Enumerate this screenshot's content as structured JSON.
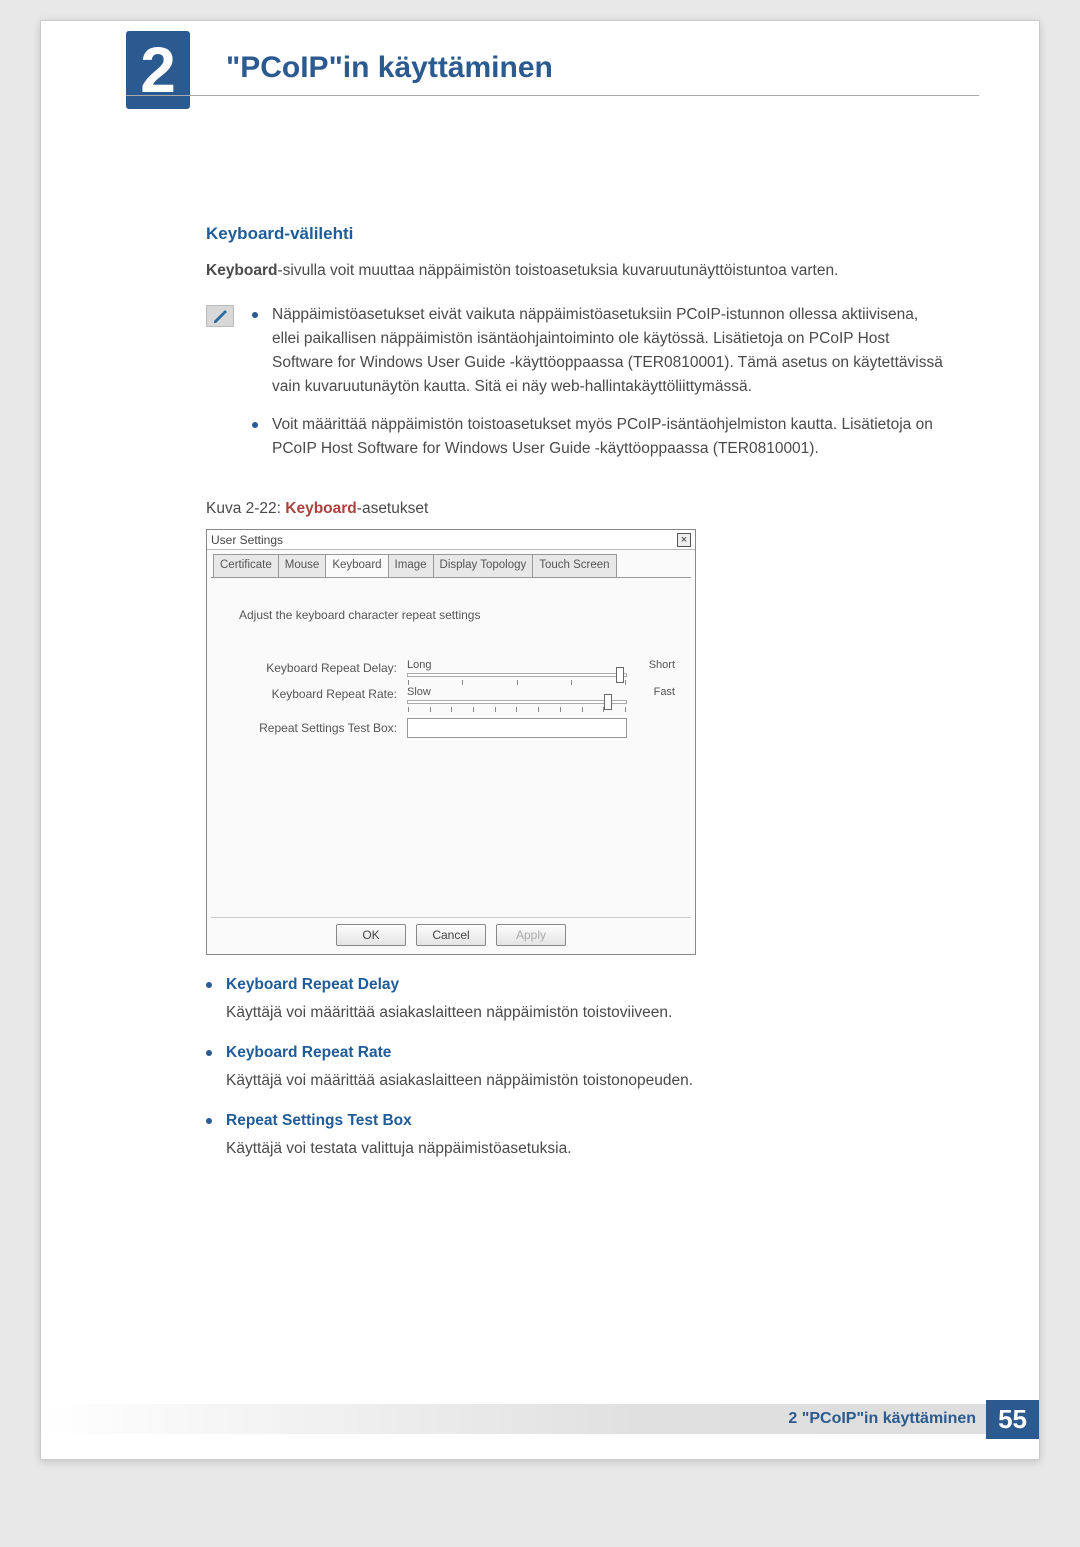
{
  "chapter": {
    "number": "2",
    "title": "\"PCoIP\"in käyttäminen"
  },
  "section": {
    "title": "Keyboard-välilehti",
    "intro_bold": "Keyboard",
    "intro_rest": "-sivulla voit muuttaa näppäimistön toistoasetuksia kuvaruutunäyttöistuntoa varten."
  },
  "notes": [
    "Näppäimistöasetukset eivät vaikuta näppäimistöasetuksiin PCoIP-istunnon ollessa aktiivisena, ellei paikallisen näppäimistön isäntäohjaintoiminto ole käytössä. Lisätietoja on PCoIP Host Software for Windows User Guide -käyttöoppaassa (TER0810001). Tämä asetus on käytettävissä vain kuvaruutunäytön kautta. Sitä ei näy web-hallintakäyttöliittymässä.",
    "Voit määrittää näppäimistön toistoasetukset myös PCoIP-isäntäohjelmiston kautta. Lisätietoja on PCoIP Host Software for Windows User Guide -käyttöoppaassa (TER0810001)."
  ],
  "caption": {
    "prefix": "Kuva 2-22: ",
    "bold": "Keyboard",
    "suffix": "-asetukset"
  },
  "dialog": {
    "title": "User Settings",
    "close": "×",
    "tabs": [
      "Certificate",
      "Mouse",
      "Keyboard",
      "Image",
      "Display Topology",
      "Touch Screen"
    ],
    "active_tab_index": 2,
    "description": "Adjust the keyboard character repeat settings",
    "rows": {
      "delay": {
        "label": "Keyboard Repeat Delay:",
        "left": "Long",
        "right": "Short"
      },
      "rate": {
        "label": "Keyboard Repeat Rate:",
        "left": "Slow",
        "right": "Fast"
      },
      "test": {
        "label": "Repeat Settings Test Box:"
      }
    },
    "buttons": {
      "ok": "OK",
      "cancel": "Cancel",
      "apply": "Apply"
    }
  },
  "definitions": [
    {
      "term": "Keyboard Repeat Delay",
      "body": "Käyttäjä voi määrittää asiakaslaitteen näppäimistön toistoviiveen."
    },
    {
      "term": "Keyboard Repeat Rate",
      "body": "Käyttäjä voi määrittää asiakaslaitteen näppäimistön toistonopeuden."
    },
    {
      "term": "Repeat Settings Test Box",
      "body": "Käyttäjä voi testata valittuja näppäimistöasetuksia."
    }
  ],
  "footer": {
    "text": "2 \"PCoIP\"in käyttäminen",
    "page": "55"
  }
}
